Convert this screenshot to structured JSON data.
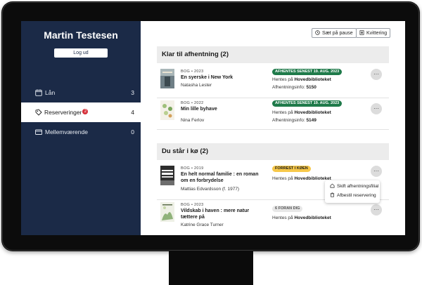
{
  "sidebar": {
    "user_name": "Martin Testesen",
    "logout_label": "Log ud",
    "items": [
      {
        "label": "Lån",
        "count": "3",
        "icon": "calendar-icon"
      },
      {
        "label": "Reserveringer",
        "badge": "2",
        "count": "4",
        "icon": "clock-tag-icon"
      },
      {
        "label": "Mellemværende",
        "count": "0",
        "icon": "card-icon"
      }
    ]
  },
  "toolbar": {
    "pause_label": "Sæt på pause",
    "receipt_label": "Kvittering"
  },
  "ready": {
    "heading": "Klar til afhentning (2)",
    "items": [
      {
        "meta": "BOG • 2023",
        "title": "En syerske i New York",
        "author": "Natasha Lester",
        "pill": "AFHENTES SENEST 19. AUG. 2023",
        "pickup_prefix": "Hentes på ",
        "pickup_branch": "Hovedbiblioteket",
        "info_prefix": "Afhentningsinfo: ",
        "info_code": "5150"
      },
      {
        "meta": "BOG • 2022",
        "title": "Min lille byhave",
        "author": "Nina Ferlov",
        "pill": "AFHENTES SENEST 19. AUG. 2023",
        "pickup_prefix": "Hentes på ",
        "pickup_branch": "Hovedbiblioteket",
        "info_prefix": "Afhentningsinfo: ",
        "info_code": "5149"
      }
    ]
  },
  "queue": {
    "heading": "Du står i kø (2)",
    "items": [
      {
        "meta": "BOG • 2019",
        "title": "En helt normal familie : en roman om en forbrydelse",
        "author": "Mattias Edvardsson (f. 1977)",
        "pill": "FORREST I KØEN",
        "pickup_prefix": "Hentes på ",
        "pickup_branch": "Hovedbiblioteket"
      },
      {
        "meta": "BOG • 2023",
        "title": "Vildskab i haven : mere natur tættere på",
        "author": "Katrine Grace Turner",
        "pill": "6 FORAN DIG",
        "pickup_prefix": "Hentes på ",
        "pickup_branch": "Hovedbiblioteket"
      }
    ]
  },
  "menu": {
    "change_branch": "Skift afhentningsfilial",
    "cancel": "Afbestil reservering"
  },
  "more_symbol": "···",
  "colors": {
    "sidebar": "#1b2a47",
    "green": "#1f7a4a",
    "yellow": "#f7c84a",
    "badge": "#d6313b"
  }
}
